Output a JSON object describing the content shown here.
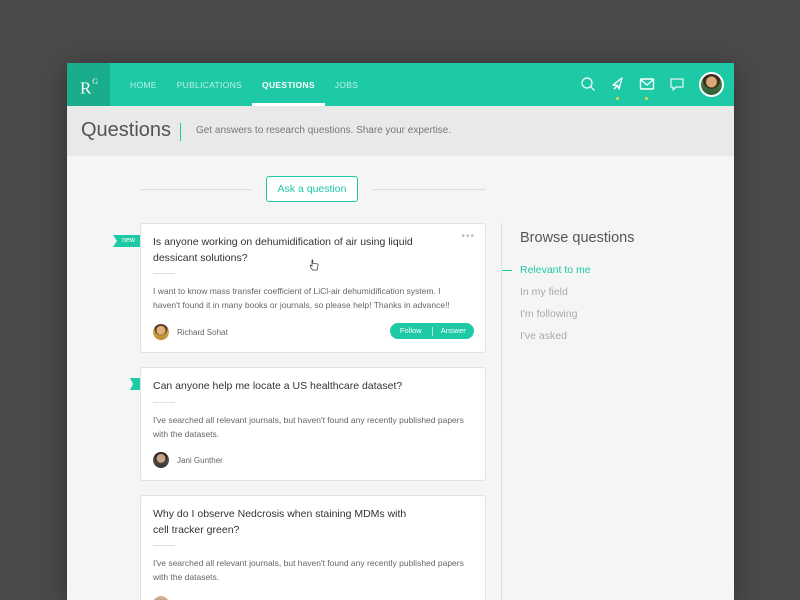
{
  "logo": {
    "letter": "R",
    "sup": "G"
  },
  "nav": {
    "items": [
      {
        "label": "HOME"
      },
      {
        "label": "PUBLICATIONS"
      },
      {
        "label": "QUESTIONS"
      },
      {
        "label": "JOBS"
      }
    ],
    "active": "QUESTIONS",
    "icons": [
      "search-icon",
      "notifications-icon",
      "messages-icon",
      "chat-icon"
    ]
  },
  "header": {
    "title": "Questions",
    "subtitle": "Get answers to research questions. Share your expertise."
  },
  "ask_button": "Ask a question",
  "questions": [
    {
      "tag": "new",
      "title": "Is anyone working on dehumidification of air using liquid dessicant solutions?",
      "body": "I want to know mass transfer coefficient of LiCl-air dehumidification system. I haven't found it in many books or journals, so please help! Thanks in advance!!",
      "author": "Richard Sohat",
      "follow_label": "Follow",
      "answer_label": "Answer"
    },
    {
      "title": "Can anyone help me locate a US healthcare dataset?",
      "body": "I've searched all relevant journals, but haven't found any recently published papers with the datasets.",
      "author": "Jani Gunther"
    },
    {
      "title": "Why do I observe Nedcrosis when staining MDMs with cell tracker green?",
      "body": "I've searched all relevant journals, but haven't found any recently published papers with the datasets."
    }
  ],
  "browse": {
    "title": "Browse questions",
    "items": [
      {
        "label": "Relevant to me",
        "active": true
      },
      {
        "label": "In my field"
      },
      {
        "label": "I'm following"
      },
      {
        "label": "I've asked"
      }
    ]
  },
  "colors": {
    "accent": "#1ec9a6",
    "accent_dark": "#19ad8e",
    "badge_dot": "#f5d13a"
  }
}
